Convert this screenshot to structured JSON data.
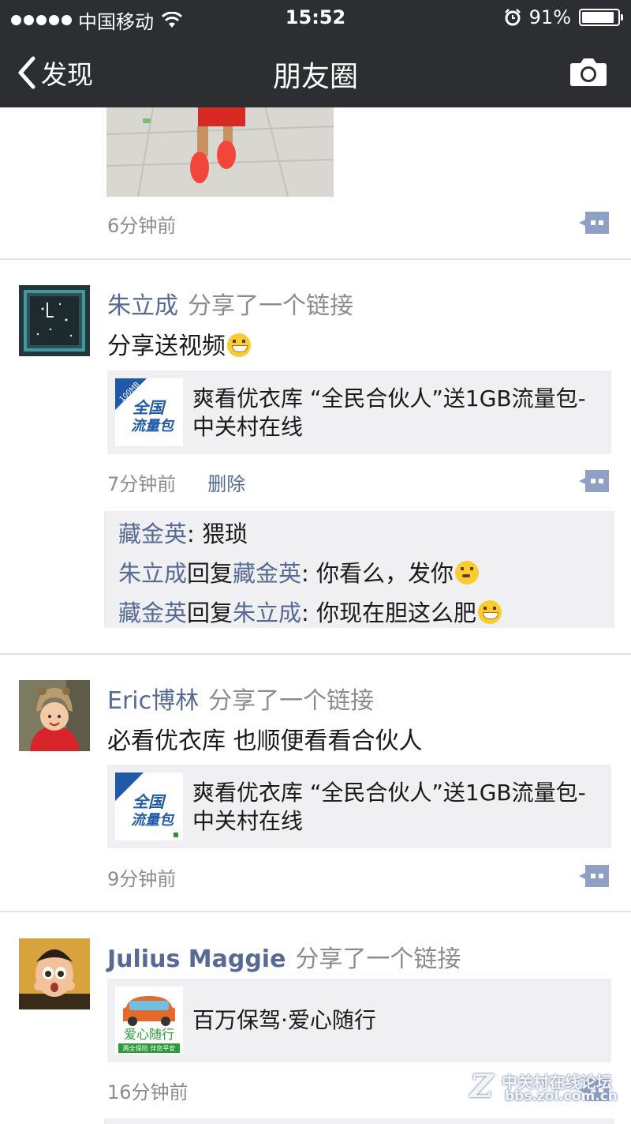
{
  "status_bar": {
    "carrier": "中国移动",
    "time": "15:52",
    "battery": "91%",
    "battery_level": 0.91
  },
  "nav": {
    "back_label": "发现",
    "title": "朋友圈",
    "camera_icon": "camera-icon"
  },
  "posts": [
    {
      "time": "6分钟前"
    },
    {
      "author": "朱立成",
      "action": "分享了一个链接",
      "text": "分享送视频",
      "link_title": "爽看优衣库 “全民合伙人”送1GB流量包-中关村在线",
      "link_thumb_text": "全国流量包",
      "link_thumb_badge": "100MB",
      "time": "7分钟前",
      "delete_label": "删除",
      "comments": [
        {
          "user": "藏金英",
          "reply_prefix": "",
          "reply_to": "",
          "text": ": 猥琐"
        },
        {
          "user": "朱立成",
          "reply_prefix": "回复",
          "reply_to": "藏金英",
          "text": ": 你看么，发你"
        },
        {
          "user": "藏金英",
          "reply_prefix": "回复",
          "reply_to": "朱立成",
          "text": ": 你现在胆这么肥"
        }
      ]
    },
    {
      "author": "Eric博林",
      "action": "分享了一个链接",
      "text": "必看优衣库 也顺便看看合伙人",
      "link_title": "爽看优衣库 “全民合伙人”送1GB流量包-中关村在线",
      "link_thumb_text": "全国流量包",
      "time": "9分钟前"
    },
    {
      "author": "Julius Maggie",
      "action": "分享了一个链接",
      "link_title": "百万保驾·爱心随行",
      "link_thumb_text": "爱心随行",
      "link_thumb_sub": "两全保险 伴您平安",
      "time": "16分钟前"
    }
  ],
  "watermark": {
    "line1": "中关村在线论坛",
    "line2": "bbs.zol.com.cn"
  },
  "colors": {
    "nav_bg": "#2d2e31",
    "name_blue": "#566a93",
    "gray_text": "#8c8c8c",
    "panel_bg": "#f0f0f2"
  }
}
